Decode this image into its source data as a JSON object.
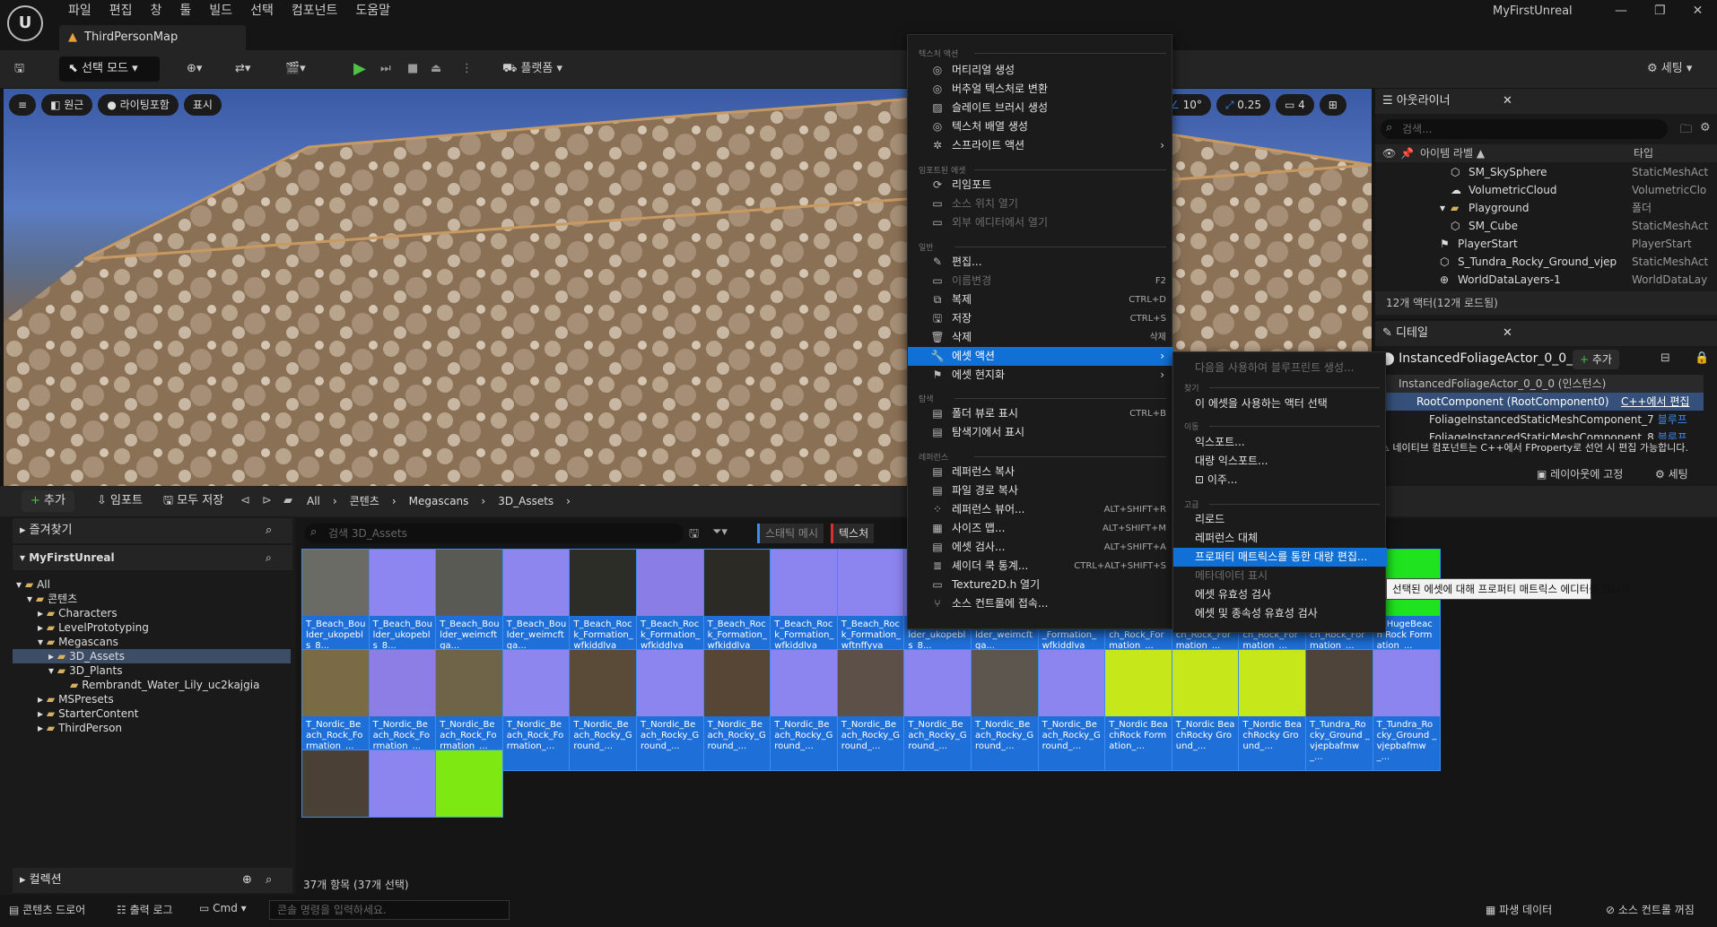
{
  "app": {
    "menu": [
      "파일",
      "편집",
      "창",
      "툴",
      "빌드",
      "선택",
      "컴포넌트",
      "도움말"
    ],
    "project_name": "MyFirstUnreal",
    "doc_tab": "ThirdPersonMap"
  },
  "toolbar": {
    "mode": "선택 모드",
    "platform": "플랫폼",
    "settings": "세팅"
  },
  "viewport": {
    "perspective": "원근",
    "lighting": "라이팅포함",
    "show": "표시",
    "angle_snap": "10°",
    "scale_snap": "0.25",
    "camera_speed": "4"
  },
  "outliner": {
    "title": "아웃라이너",
    "search_placeholder": "검색...",
    "col_label": "아이템 라벨 ▲",
    "col_type": "타입",
    "rows": [
      {
        "label": "SM_SkySphere",
        "type": "StaticMeshAct"
      },
      {
        "label": "VolumetricCloud",
        "type": "VolumetricClo"
      },
      {
        "label": "Playground",
        "type": "폴더"
      },
      {
        "label": "SM_Cube",
        "type": "StaticMeshAct"
      },
      {
        "label": "PlayerStart",
        "type": "PlayerStart"
      },
      {
        "label": "S_Tundra_Rocky_Ground_vjep",
        "type": "StaticMeshAct"
      },
      {
        "label": "WorldDataLayers-1",
        "type": "WorldDataLay"
      }
    ],
    "footer": "12개 액터(12개 로드됨)"
  },
  "details": {
    "title": "디테일",
    "actor": "InstancedFoliageActor_0_0_0",
    "add": "추가",
    "instance": "InstancedFoliageActor_0_0_0 (인스턴스)",
    "root": "RootComponent (RootComponent0)",
    "cpp_edit": "C++에서 편집",
    "comp1": "FoliageInstancedStaticMeshComponent_7",
    "comp1_link": "블루프",
    "comp2": "FoliageInstancedStaticMeshComponent_8",
    "comp2_link": "블루프",
    "warning": "네이티브 컴포넌트는 C++에서 FProperty로 선언 시 편집 가능합니다.",
    "lock_layout": "레이아웃에 고정",
    "settings": "세팅"
  },
  "content_browser": {
    "add": "추가",
    "import": "임포트",
    "save_all": "모두 저장",
    "breadcrumb": [
      "All",
      "콘텐츠",
      "Megascans",
      "3D_Assets"
    ],
    "favorites": "즐겨찾기",
    "project": "MyFirstUnreal",
    "collections": "컬렉션",
    "search_placeholder": "검색 3D_Assets",
    "filter_static_mesh": "스태틱 메시",
    "filter_texture": "텍스처",
    "item_count": "37개 항목 (37개 선택)",
    "tree": [
      "All",
      "콘텐츠",
      "Characters",
      "LevelPrototyping",
      "Megascans",
      "3D_Assets",
      "3D_Plants",
      "Rembrandt_Water_Lily_uc2kajgia",
      "MSPresets",
      "StarterContent",
      "ThirdPerson"
    ],
    "tiles": [
      {
        "label": "T_Beach_Boulder_ukopebls_8...",
        "thumb": "#6b6b66"
      },
      {
        "label": "T_Beach_Boulder_ukopebls_8...",
        "thumb": "#8d86f0"
      },
      {
        "label": "T_Beach_Boulder_weimcftga...",
        "thumb": "#5a5a55"
      },
      {
        "label": "T_Beach_Boulder_weimcftga...",
        "thumb": "#8e86ef"
      },
      {
        "label": "T_Beach_Rock_Formation_wfkiddlva_1...",
        "thumb": "#2d2d28"
      },
      {
        "label": "T_Beach_Rock_Formation_wfkiddlva_1...",
        "thumb": "#8a7ee6"
      },
      {
        "label": "T_Beach_Rock_Formation_wfkiddlva_8...",
        "thumb": "#2b2a25"
      },
      {
        "label": "T_Beach_Rock_Formation_wfkiddlva_8...",
        "thumb": "#8d85ef"
      },
      {
        "label": "T_Beach_Rock_Formation_wftnffyva_1...",
        "thumb": "#8d85ef"
      },
      {
        "label": "T_Beach_Boulder_ukopebls_8...",
        "thumb": "#8c86ef"
      },
      {
        "label": "T_Beach_Boulder_weimcftga...",
        "thumb": "#8c86ef"
      },
      {
        "label": "T_BeachRock_Formation_wfkiddlva_8...",
        "thumb": "#8d85ef"
      },
      {
        "label": "T_Huge_Beach_Rock_Formation_...",
        "thumb": "#8d85ef"
      },
      {
        "label": "T_Huge_Beach_Rock_Formation_...",
        "thumb": "#8a85ef"
      },
      {
        "label": "T_Huge_Beach_Rock_Formation_...",
        "thumb": "#3f3f3a"
      },
      {
        "label": "T_Huge_Beach_Rock_Formation_...",
        "thumb": "#8d85ef"
      },
      {
        "label": "T_HugeBeach Rock Formation_...",
        "thumb": "#1fe31f"
      },
      {
        "label": "T_Nordic_Beach_Rock_Formation_...",
        "thumb": "#7a6a45"
      },
      {
        "label": "T_Nordic_Beach_Rock_Formation_...",
        "thumb": "#8d7ee6"
      },
      {
        "label": "T_Nordic_Beach_Rock_Formation_...",
        "thumb": "#6f6448"
      },
      {
        "label": "T_Nordic_Beach_Rock_Formation_...",
        "thumb": "#8d86ef"
      },
      {
        "label": "T_Nordic_Beach_Rocky_Ground_...",
        "thumb": "#5a4a38"
      },
      {
        "label": "T_Nordic_Beach_Rocky_Ground_...",
        "thumb": "#8d85ef"
      },
      {
        "label": "T_Nordic_Beach_Rocky_Ground_...",
        "thumb": "#574636"
      },
      {
        "label": "T_Nordic_Beach_Rocky_Ground_...",
        "thumb": "#8d85ef"
      },
      {
        "label": "T_Nordic_Beach_Rocky_Ground_...",
        "thumb": "#5c5048"
      },
      {
        "label": "T_Nordic_Beach_Rocky_Ground_...",
        "thumb": "#8d85ef"
      },
      {
        "label": "T_Nordic_Beach_Rocky_Ground_...",
        "thumb": "#5d564e"
      },
      {
        "label": "T_Nordic_Beach_Rocky_Ground_...",
        "thumb": "#8d85ef"
      },
      {
        "label": "T_Nordic BeachRock Formation_...",
        "thumb": "#c6e81a"
      },
      {
        "label": "T_Nordic BeachRocky Ground_...",
        "thumb": "#c6e81a"
      },
      {
        "label": "T_Nordic BeachRocky Ground_...",
        "thumb": "#c6e81a"
      },
      {
        "label": "T_Tundra_Rocky_Ground _vjepbafmw_...",
        "thumb": "#4e4439"
      },
      {
        "label": "T_Tundra_Rocky_Ground _vjepbafmw_...",
        "thumb": "#8d85ef"
      },
      {
        "label": "",
        "thumb": "#4a4035"
      },
      {
        "label": "",
        "thumb": "#8d85ef"
      },
      {
        "label": "",
        "thumb": "#7de812"
      }
    ]
  },
  "statusbar": {
    "content_drawer": "콘텐츠 드로어",
    "output_log": "출력 로그",
    "cmd": "Cmd",
    "console_placeholder": "콘솔 명령을 입력하세요.",
    "derived_data": "파생 데이터",
    "source_control": "소스 컨트롤 꺼짐"
  },
  "context_menu": {
    "sections": [
      "텍스처 액션",
      "임포트된 에셋",
      "일반",
      "탐색",
      "레퍼런스"
    ],
    "texture_actions": [
      "머티리얼 생성",
      "버추얼 텍스처로 변환",
      "슬레이트 브러시 생성",
      "텍스처 배열 생성",
      "스프라이트 액션"
    ],
    "imported": [
      "리임포트",
      "소스 위치 열기",
      "외부 에디터에서 열기"
    ],
    "general": [
      {
        "label": "편집...",
        "shortcut": ""
      },
      {
        "label": "이름변경",
        "shortcut": "F2"
      },
      {
        "label": "복제",
        "shortcut": "CTRL+D"
      },
      {
        "label": "저장",
        "shortcut": "CTRL+S"
      },
      {
        "label": "삭제",
        "shortcut": "삭제"
      },
      {
        "label": "에셋 액션",
        "shortcut": ""
      },
      {
        "label": "에셋 현지화",
        "shortcut": ""
      }
    ],
    "explore": [
      {
        "label": "폴더 뷰로 표시",
        "shortcut": "CTRL+B"
      },
      {
        "label": "탐색기에서 표시",
        "shortcut": ""
      }
    ],
    "references": [
      {
        "label": "레퍼런스 복사",
        "shortcut": ""
      },
      {
        "label": "파일 경로 복사",
        "shortcut": ""
      },
      {
        "label": "레퍼런스 뷰어...",
        "shortcut": "ALT+SHIFT+R"
      },
      {
        "label": "사이즈 맵...",
        "shortcut": "ALT+SHIFT+M"
      },
      {
        "label": "에셋 검사...",
        "shortcut": "ALT+SHIFT+A"
      },
      {
        "label": "셰이더 쿡 통계...",
        "shortcut": "CTRL+ALT+SHIFT+S"
      },
      {
        "label": "Texture2D.h 열기",
        "shortcut": ""
      },
      {
        "label": "소스 컨트롤에 접속...",
        "shortcut": ""
      }
    ]
  },
  "submenu": {
    "top": "다음을 사용하여 블루프린트 생성...",
    "sec_find": "찾기",
    "select_actors": "이 에셋을 사용하는 액터 선택",
    "sec_move": "이동",
    "export": "익스포트...",
    "bulk_export": "대량 익스포트...",
    "migrate": "이주...",
    "sec_advanced": "고급",
    "reload": "리로드",
    "replace_refs": "레퍼런스 대체",
    "bulk_edit": "프로퍼티 매트릭스를 통한 대량 편집...",
    "show_metadata": "메타데이터 표시",
    "validate": "에셋 유효성 검사",
    "validate_deps": "에셋 및 종속성 유효성 검사"
  },
  "tooltip": "선택된 에셋에 대해 프로퍼티 매트릭스 에디터를 엽니다."
}
